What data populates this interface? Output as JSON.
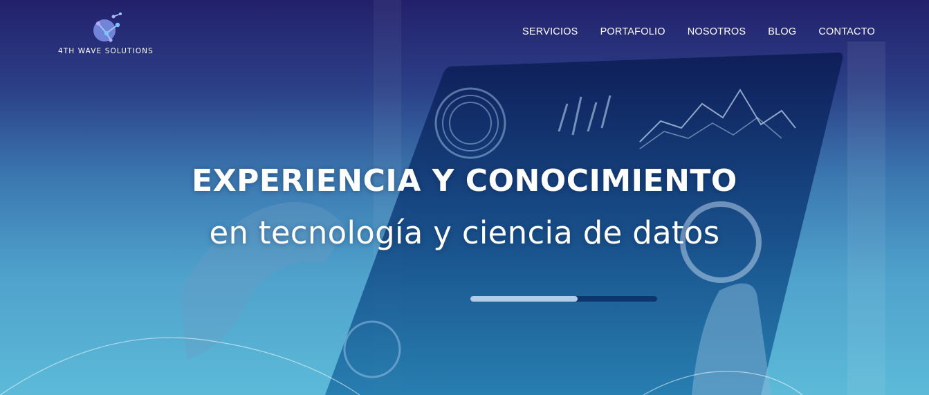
{
  "brand": {
    "name": "4TH WAVE SOLUTIONS",
    "logo_icon": "molecule-wave-logo-icon"
  },
  "nav": {
    "items": [
      {
        "label": "SERVICIOS"
      },
      {
        "label": "PORTAFOLIO"
      },
      {
        "label": "NOSOTROS"
      },
      {
        "label": "BLOG"
      },
      {
        "label": "CONTACTO"
      }
    ]
  },
  "hero": {
    "headline": "EXPERIENCIA Y CONOCIMIENTO",
    "subheadline": "en tecnología y ciencia de datos"
  },
  "colors": {
    "top_gradient": "#23206b",
    "bottom_gradient": "#5cbad8",
    "logo_purple": "#8a78d8",
    "logo_blue": "#5aa8e8"
  }
}
